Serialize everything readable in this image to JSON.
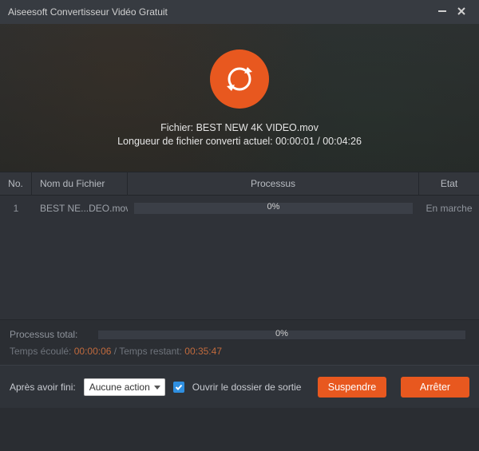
{
  "window": {
    "title": "Aiseesoft Convertisseur Vidéo Gratuit"
  },
  "hero": {
    "file_label": "Fichier:",
    "file_name": "BEST NEW 4K VIDEO.mov",
    "length_label": "Longueur de fichier converti actuel:",
    "elapsed": "00:00:01",
    "total": "00:04:26"
  },
  "table": {
    "headers": {
      "no": "No.",
      "name": "Nom du Fichier",
      "proc": "Processus",
      "stat": "Etat"
    },
    "rows": [
      {
        "no": "1",
        "name": "BEST NE...DEO.mov",
        "pct": "0%",
        "stat": "En marche"
      }
    ]
  },
  "totals": {
    "label": "Processus total:",
    "pct": "0%",
    "time_elapsed_label": "Temps écoulé:",
    "time_elapsed": "00:00:06",
    "time_remaining_label": "Temps restant:",
    "time_remaining": "00:35:47"
  },
  "footer": {
    "after_label": "Après avoir fini:",
    "after_value": "Aucune action",
    "open_folder": "Ouvrir le dossier de sortie",
    "suspend": "Suspendre",
    "stop": "Arrêter"
  }
}
